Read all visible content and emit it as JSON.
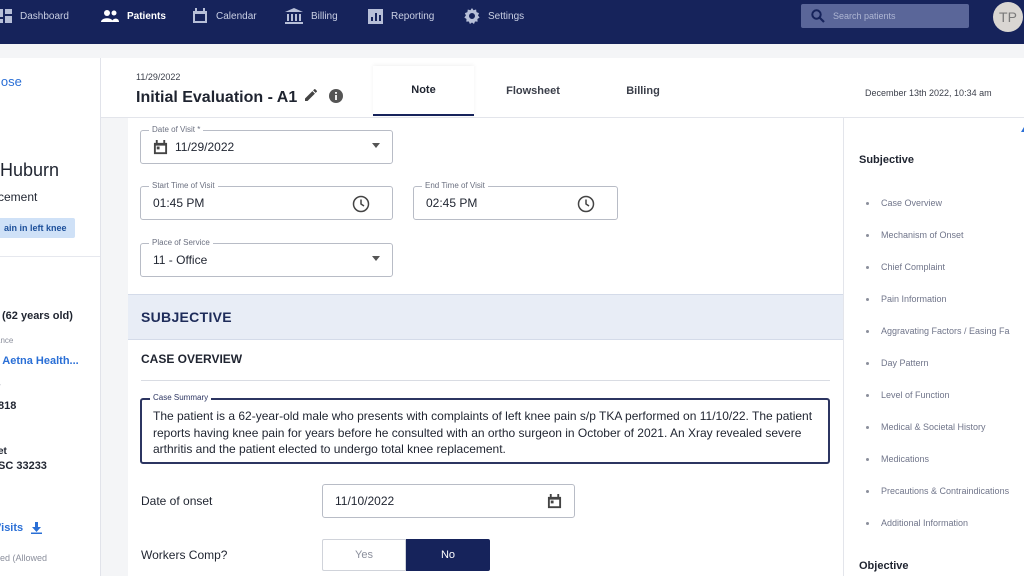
{
  "nav": {
    "items": [
      {
        "label": "Dashboard",
        "icon": "dashboard-icon",
        "active": false
      },
      {
        "label": "Patients",
        "icon": "patients-icon",
        "active": true
      },
      {
        "label": "Calendar",
        "icon": "calendar-icon",
        "active": false
      },
      {
        "label": "Billing",
        "icon": "billing-icon",
        "active": false
      },
      {
        "label": "Reporting",
        "icon": "reporting-icon",
        "active": false
      },
      {
        "label": "Settings",
        "icon": "settings-icon",
        "active": false
      }
    ],
    "search_placeholder": "Search patients",
    "avatar_initials": "TP"
  },
  "patient": {
    "close_label": "lose",
    "name": "Huburn",
    "subtitle": "cement",
    "complaint": "ain in left knee",
    "age": "(62 years old)",
    "insurance_label": "ance",
    "insurance_value": ": Aetna Health...",
    "phone_label": "r",
    "phone_value": "818",
    "address_label": "et",
    "address_value": "SC 33233",
    "dot": ".",
    "visits_label": "Visits",
    "allowed_text": "led (Allowed"
  },
  "note": {
    "date": "11/29/2022",
    "title": "Initial Evaluation - A1",
    "timestamp": "December 13th 2022, 10:34 am",
    "tabs": [
      {
        "label": "Note",
        "active": true
      },
      {
        "label": "Flowsheet",
        "active": false
      },
      {
        "label": "Billing",
        "active": false
      }
    ]
  },
  "form": {
    "date_of_visit_label": "Date of Visit *",
    "date_of_visit_value": "11/29/2022",
    "start_time_label": "Start Time of Visit",
    "start_time_value": "01:45 PM",
    "end_time_label": "End Time of Visit",
    "end_time_value": "02:45 PM",
    "place_label": "Place of Service",
    "place_value": "11 - Office",
    "section_title": "SUBJECTIVE",
    "case_overview_title": "CASE OVERVIEW",
    "case_summary_label": "Case Summary",
    "case_summary_text": "The patient is a 62-year-old male who presents with complaints of left knee pain s/p TKA performed on 11/10/22.  The patient reports having knee pain for years before he consulted with an ortho surgeon in October of 2021.  An Xray revealed severe arthritis and the patient elected to undergo total knee replacement.",
    "onset_label": "Date of onset",
    "onset_value": "11/10/2022",
    "workers_comp_label": "Workers Comp?",
    "workers_comp_yes": "Yes",
    "workers_comp_no": "No",
    "workers_comp_selected": "No"
  },
  "outline": {
    "subjective_heading": "Subjective",
    "subjective_items": [
      "Case Overview",
      "Mechanism of Onset",
      "Chief Complaint",
      "Pain Information",
      "Aggravating Factors / Easing Fa",
      "Day Pattern",
      "Level of Function",
      "Medical & Societal History",
      "Medications",
      "Precautions & Contraindications",
      "Additional Information"
    ],
    "objective_heading": "Objective"
  },
  "colors": {
    "nav_bg": "#16235b",
    "accent": "#2a6fd6",
    "selected_segment": "#16235b",
    "section_band": "#e8edf6"
  }
}
